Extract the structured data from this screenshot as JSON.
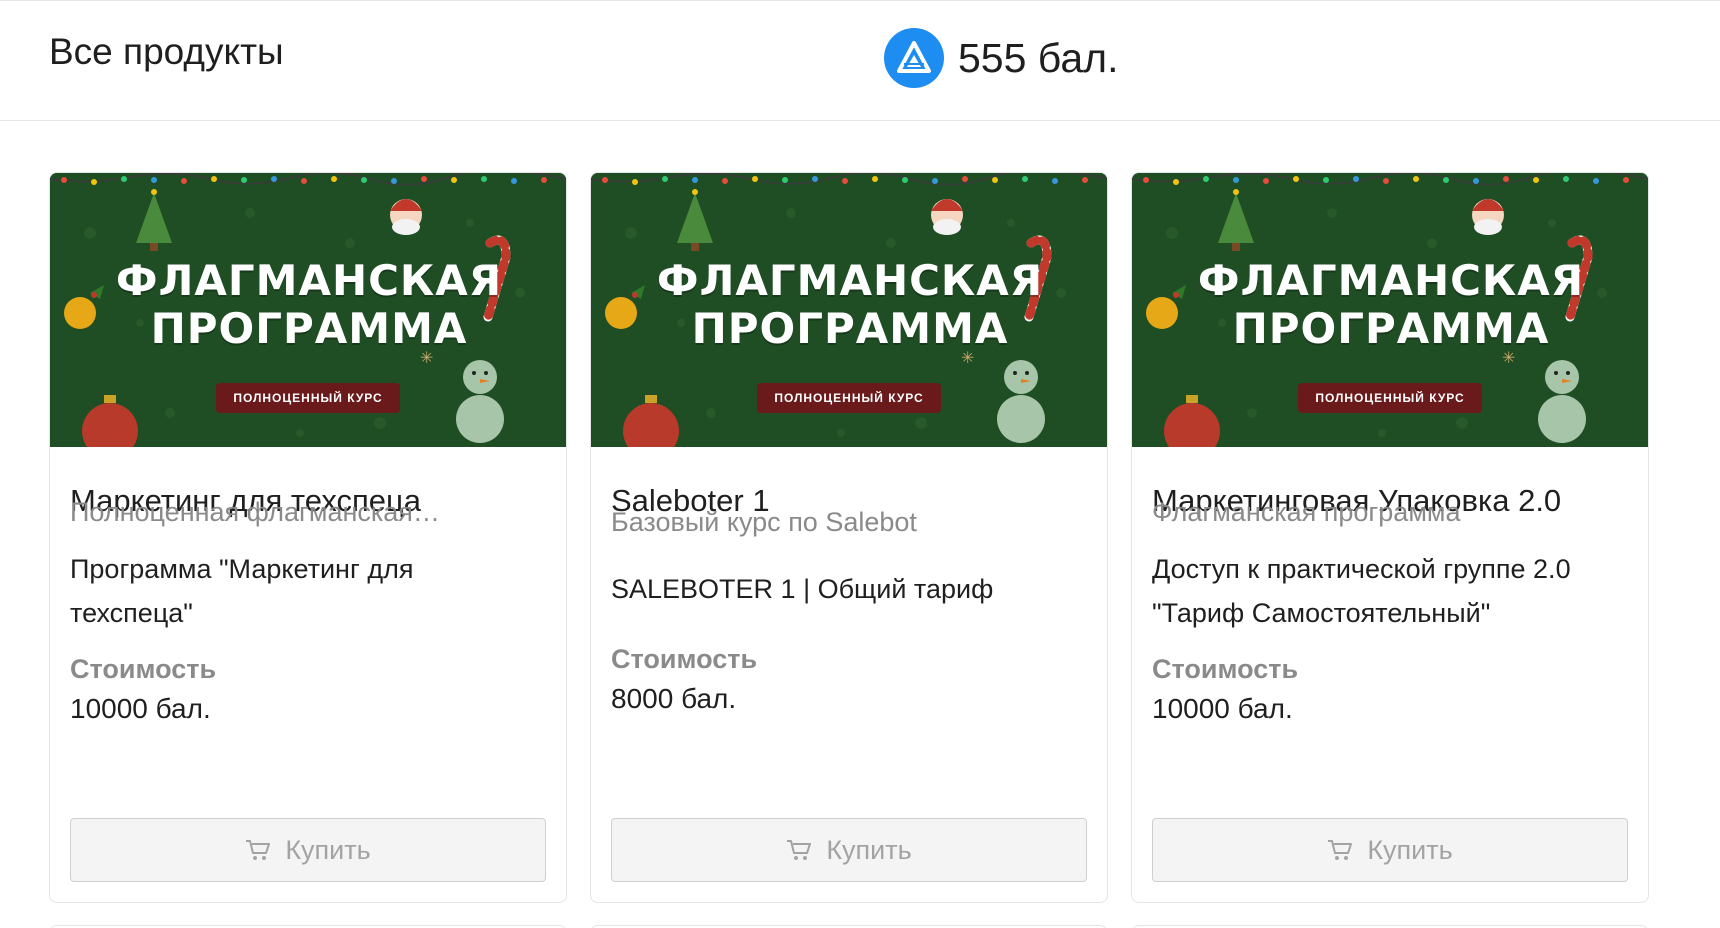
{
  "header": {
    "title": "Все продукты",
    "balance": "555 бал.",
    "balance_icon": "triangle-logo-icon",
    "accent_color": "#1e8df2"
  },
  "products": [
    {
      "banner_line1": "ФЛАГМАНСКАЯ",
      "banner_line2": "ПРОГРАММА",
      "banner_badge": "ПОЛНОЦЕННЫЙ КУРС",
      "title": "Маркетинг для техспеца",
      "subtitle": "Полноценная флагманская…",
      "description": "Программа \"Маркетинг для техспеца\"",
      "price_label": "Стоимость",
      "price": "10000 бал.",
      "buy_label": "Купить"
    },
    {
      "banner_line1": "ФЛАГМАНСКАЯ",
      "banner_line2": "ПРОГРАММА",
      "banner_badge": "ПОЛНОЦЕННЫЙ КУРС",
      "title": "Saleboter 1",
      "subtitle": "Базовый курс по Salebot",
      "description": "SALEBOTER 1 | Общий тариф",
      "price_label": "Стоимость",
      "price": "8000 бал.",
      "buy_label": "Купить"
    },
    {
      "banner_line1": "ФЛАГМАНСКАЯ",
      "banner_line2": "ПРОГРАММА",
      "banner_badge": "ПОЛНОЦЕННЫЙ КУРС",
      "title": "Маркетинговая Упаковка 2.0",
      "subtitle": "Флагманская программа",
      "description": "Доступ к практической группе 2.0 \"Тариф Самостоятельный\"",
      "price_label": "Стоимость",
      "price": "10000 бал.",
      "buy_label": "Купить"
    }
  ],
  "colors": {
    "banner_green": "#1f4d24",
    "badge_red": "#6b1a1c",
    "muted_text": "#8a8a8a"
  }
}
